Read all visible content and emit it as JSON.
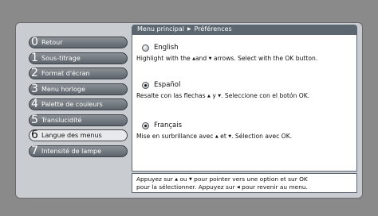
{
  "breadcrumb": {
    "root": "Menu principal",
    "current": "Préférences"
  },
  "menu": [
    {
      "num": "0",
      "label": "Retour"
    },
    {
      "num": "1",
      "label": "Sous-titrage"
    },
    {
      "num": "2",
      "label": "Format d'écran"
    },
    {
      "num": "3",
      "label": "Menu horloge"
    },
    {
      "num": "4",
      "label": "Palette de couleurs"
    },
    {
      "num": "5",
      "label": "Translucidité"
    },
    {
      "num": "6",
      "label": "Langue des menus"
    },
    {
      "num": "7",
      "label": "Intensité de lampe"
    }
  ],
  "options": [
    {
      "title": "English",
      "desc_a": "Highlight with the ",
      "desc_b": "and ",
      "desc_c": " arrows. Select with the OK button."
    },
    {
      "title": "Español",
      "desc_a": "Resalte con las flechas ",
      "desc_b": " y ",
      "desc_c": ". Seleccione con el botón OK."
    },
    {
      "title": "Français",
      "desc_a": "Mise en surbrillance avec ",
      "desc_b": " et ",
      "desc_c": ". Sélection avec OK."
    }
  ],
  "help": {
    "line1_a": "Appuyez sur ",
    "line1_b": " ou ",
    "line1_c": " pour pointer vers une option et sur OK",
    "line2_a": "pour la sélectionner. Appuyez sur ",
    "line2_b": " pour revenir au menu."
  },
  "icons": {
    "up": "▲",
    "down": "▼",
    "left": "◀",
    "crumb": "▶"
  }
}
